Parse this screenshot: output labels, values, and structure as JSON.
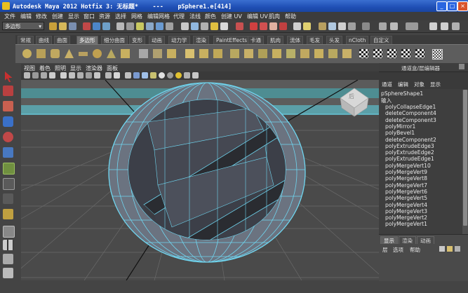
{
  "window": {
    "title": "Autodesk Maya 2012 Hotfix 3: 无标题*    ---    pSphere1.e[414]",
    "btn_min": "_",
    "btn_max": "□",
    "btn_close": "×"
  },
  "menubar": [
    "文件",
    "编辑",
    "修改",
    "创建",
    "显示",
    "窗口",
    "资源",
    "选择",
    "网格",
    "编辑网格",
    "代理",
    "法线",
    "颜色",
    "创建 UV",
    "编辑 UV",
    "肌肉",
    "帮助"
  ],
  "status": {
    "mode": "多边形",
    "dropdown_arrow": "▾"
  },
  "shelf_tabs": [
    "常规",
    "曲线",
    "曲面",
    "多边形",
    "细分曲面",
    "变形",
    "动画",
    "动力学",
    "渲染",
    "PaintEffects",
    "卡通",
    "肌肉",
    "流体",
    "毛发",
    "头发",
    "nCloth",
    "自定义"
  ],
  "active_shelf_tab": "多边形",
  "viewport_menu": [
    "视图",
    "着色",
    "照明",
    "显示",
    "渲染器",
    "面板"
  ],
  "channel_box": {
    "header": "通道盒/层编辑器",
    "menu": [
      "通道",
      "编辑",
      "对象",
      "显示"
    ],
    "object": "pSphereShape1",
    "inputs_label": "输入",
    "nodes": [
      "polyCollapseEdge1",
      "deleteComponent4",
      "deleteComponent3",
      "polyMirror1",
      "polyBevel1",
      "deleteComponent2",
      "polyExtrudeEdge3",
      "polyExtrudeEdge2",
      "polyExtrudeEdge1",
      "polyMergeVert10",
      "polyMergeVert9",
      "polyMergeVert8",
      "polyMergeVert7",
      "polyMergeVert6",
      "polyMergeVert5",
      "polyMergeVert4",
      "polyMergeVert3",
      "polyMergeVert2",
      "polyMergeVert1"
    ]
  },
  "layer_editor": {
    "tabs": [
      "显示",
      "渲染",
      "动画"
    ],
    "active_tab": "显示",
    "menu": [
      "层",
      "选项",
      "帮助"
    ]
  },
  "view_cube": {
    "face_label": "后"
  },
  "colors": {
    "accent": "#5fbfd0",
    "wire": "#6fd6f0",
    "ground": "#4a4a4a"
  }
}
